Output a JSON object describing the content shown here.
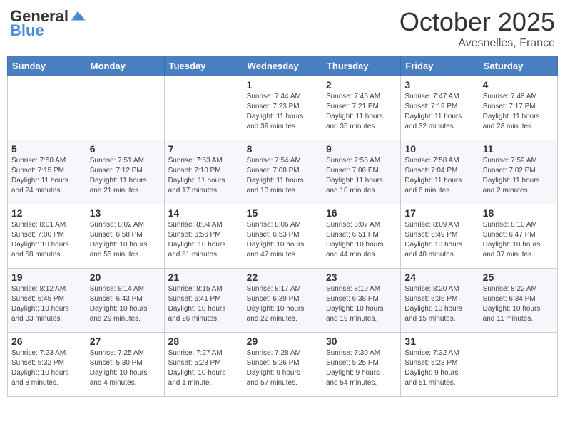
{
  "logo": {
    "general": "General",
    "blue": "Blue"
  },
  "header": {
    "month": "October 2025",
    "location": "Avesnelles, France"
  },
  "weekdays": [
    "Sunday",
    "Monday",
    "Tuesday",
    "Wednesday",
    "Thursday",
    "Friday",
    "Saturday"
  ],
  "weeks": [
    [
      {
        "day": "",
        "info": ""
      },
      {
        "day": "",
        "info": ""
      },
      {
        "day": "",
        "info": ""
      },
      {
        "day": "1",
        "info": "Sunrise: 7:44 AM\nSunset: 7:23 PM\nDaylight: 11 hours\nand 39 minutes."
      },
      {
        "day": "2",
        "info": "Sunrise: 7:45 AM\nSunset: 7:21 PM\nDaylight: 11 hours\nand 35 minutes."
      },
      {
        "day": "3",
        "info": "Sunrise: 7:47 AM\nSunset: 7:19 PM\nDaylight: 11 hours\nand 32 minutes."
      },
      {
        "day": "4",
        "info": "Sunrise: 7:48 AM\nSunset: 7:17 PM\nDaylight: 11 hours\nand 28 minutes."
      }
    ],
    [
      {
        "day": "5",
        "info": "Sunrise: 7:50 AM\nSunset: 7:15 PM\nDaylight: 11 hours\nand 24 minutes."
      },
      {
        "day": "6",
        "info": "Sunrise: 7:51 AM\nSunset: 7:12 PM\nDaylight: 11 hours\nand 21 minutes."
      },
      {
        "day": "7",
        "info": "Sunrise: 7:53 AM\nSunset: 7:10 PM\nDaylight: 11 hours\nand 17 minutes."
      },
      {
        "day": "8",
        "info": "Sunrise: 7:54 AM\nSunset: 7:08 PM\nDaylight: 11 hours\nand 13 minutes."
      },
      {
        "day": "9",
        "info": "Sunrise: 7:56 AM\nSunset: 7:06 PM\nDaylight: 11 hours\nand 10 minutes."
      },
      {
        "day": "10",
        "info": "Sunrise: 7:58 AM\nSunset: 7:04 PM\nDaylight: 11 hours\nand 6 minutes."
      },
      {
        "day": "11",
        "info": "Sunrise: 7:59 AM\nSunset: 7:02 PM\nDaylight: 11 hours\nand 2 minutes."
      }
    ],
    [
      {
        "day": "12",
        "info": "Sunrise: 8:01 AM\nSunset: 7:00 PM\nDaylight: 10 hours\nand 58 minutes."
      },
      {
        "day": "13",
        "info": "Sunrise: 8:02 AM\nSunset: 6:58 PM\nDaylight: 10 hours\nand 55 minutes."
      },
      {
        "day": "14",
        "info": "Sunrise: 8:04 AM\nSunset: 6:56 PM\nDaylight: 10 hours\nand 51 minutes."
      },
      {
        "day": "15",
        "info": "Sunrise: 8:06 AM\nSunset: 6:53 PM\nDaylight: 10 hours\nand 47 minutes."
      },
      {
        "day": "16",
        "info": "Sunrise: 8:07 AM\nSunset: 6:51 PM\nDaylight: 10 hours\nand 44 minutes."
      },
      {
        "day": "17",
        "info": "Sunrise: 8:09 AM\nSunset: 6:49 PM\nDaylight: 10 hours\nand 40 minutes."
      },
      {
        "day": "18",
        "info": "Sunrise: 8:10 AM\nSunset: 6:47 PM\nDaylight: 10 hours\nand 37 minutes."
      }
    ],
    [
      {
        "day": "19",
        "info": "Sunrise: 8:12 AM\nSunset: 6:45 PM\nDaylight: 10 hours\nand 33 minutes."
      },
      {
        "day": "20",
        "info": "Sunrise: 8:14 AM\nSunset: 6:43 PM\nDaylight: 10 hours\nand 29 minutes."
      },
      {
        "day": "21",
        "info": "Sunrise: 8:15 AM\nSunset: 6:41 PM\nDaylight: 10 hours\nand 26 minutes."
      },
      {
        "day": "22",
        "info": "Sunrise: 8:17 AM\nSunset: 6:39 PM\nDaylight: 10 hours\nand 22 minutes."
      },
      {
        "day": "23",
        "info": "Sunrise: 8:19 AM\nSunset: 6:38 PM\nDaylight: 10 hours\nand 19 minutes."
      },
      {
        "day": "24",
        "info": "Sunrise: 8:20 AM\nSunset: 6:36 PM\nDaylight: 10 hours\nand 15 minutes."
      },
      {
        "day": "25",
        "info": "Sunrise: 8:22 AM\nSunset: 6:34 PM\nDaylight: 10 hours\nand 11 minutes."
      }
    ],
    [
      {
        "day": "26",
        "info": "Sunrise: 7:23 AM\nSunset: 5:32 PM\nDaylight: 10 hours\nand 8 minutes."
      },
      {
        "day": "27",
        "info": "Sunrise: 7:25 AM\nSunset: 5:30 PM\nDaylight: 10 hours\nand 4 minutes."
      },
      {
        "day": "28",
        "info": "Sunrise: 7:27 AM\nSunset: 5:28 PM\nDaylight: 10 hours\nand 1 minute."
      },
      {
        "day": "29",
        "info": "Sunrise: 7:28 AM\nSunset: 5:26 PM\nDaylight: 9 hours\nand 57 minutes."
      },
      {
        "day": "30",
        "info": "Sunrise: 7:30 AM\nSunset: 5:25 PM\nDaylight: 9 hours\nand 54 minutes."
      },
      {
        "day": "31",
        "info": "Sunrise: 7:32 AM\nSunset: 5:23 PM\nDaylight: 9 hours\nand 51 minutes."
      },
      {
        "day": "",
        "info": ""
      }
    ]
  ]
}
